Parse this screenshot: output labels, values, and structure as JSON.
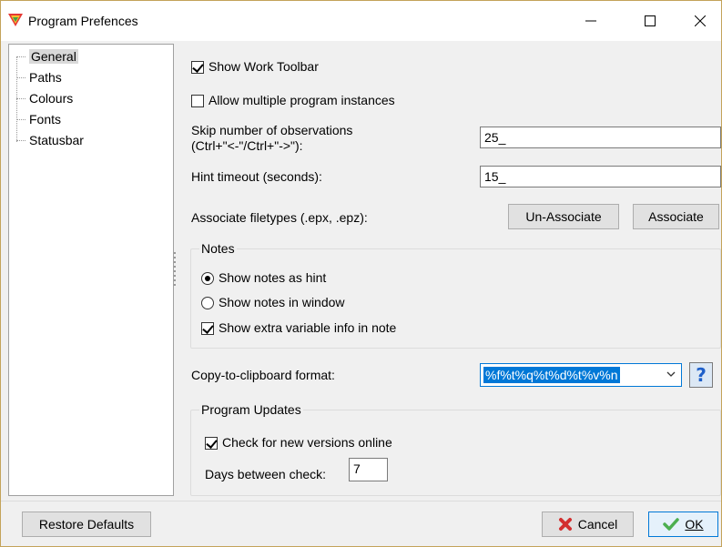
{
  "window": {
    "title": "Program Prefences"
  },
  "tree": {
    "items": [
      "General",
      "Paths",
      "Colours",
      "Fonts",
      "Statusbar"
    ],
    "selected": "General"
  },
  "general": {
    "show_work_toolbar": {
      "label": "Show Work Toolbar",
      "checked": true
    },
    "allow_multiple": {
      "label": "Allow multiple program instances",
      "checked": false
    },
    "skip_label_line1": "Skip number of observations",
    "skip_label_line2": "(Ctrl+\"<-\"/Ctrl+\"->\"):",
    "skip_value": "25_",
    "hint_label": "Hint timeout (seconds):",
    "hint_value": "15_",
    "assoc_label": "Associate filetypes (.epx, .epz):",
    "unassociate_button": "Un-Associate",
    "associate_button": "Associate"
  },
  "notes": {
    "title": "Notes",
    "show_as_hint": {
      "label": "Show notes as hint",
      "selected": true
    },
    "show_in_window": {
      "label": "Show notes in window",
      "selected": false
    },
    "extra_info": {
      "label": "Show extra variable info in note",
      "checked": true
    }
  },
  "clipboard": {
    "label": "Copy-to-clipboard format:",
    "value": "%f%t%q%t%d%t%v%n",
    "help": "?"
  },
  "updates": {
    "title": "Program Updates",
    "check_online": {
      "label": "Check for new versions online",
      "checked": true
    },
    "days_label": "Days between check:",
    "days_value": "7"
  },
  "footer": {
    "restore": "Restore Defaults",
    "cancel": "Cancel",
    "ok": "OK"
  },
  "colors": {
    "accent": "#0078d7",
    "cancel_icon": "#d32f2f",
    "ok_icon": "#4caf50"
  }
}
